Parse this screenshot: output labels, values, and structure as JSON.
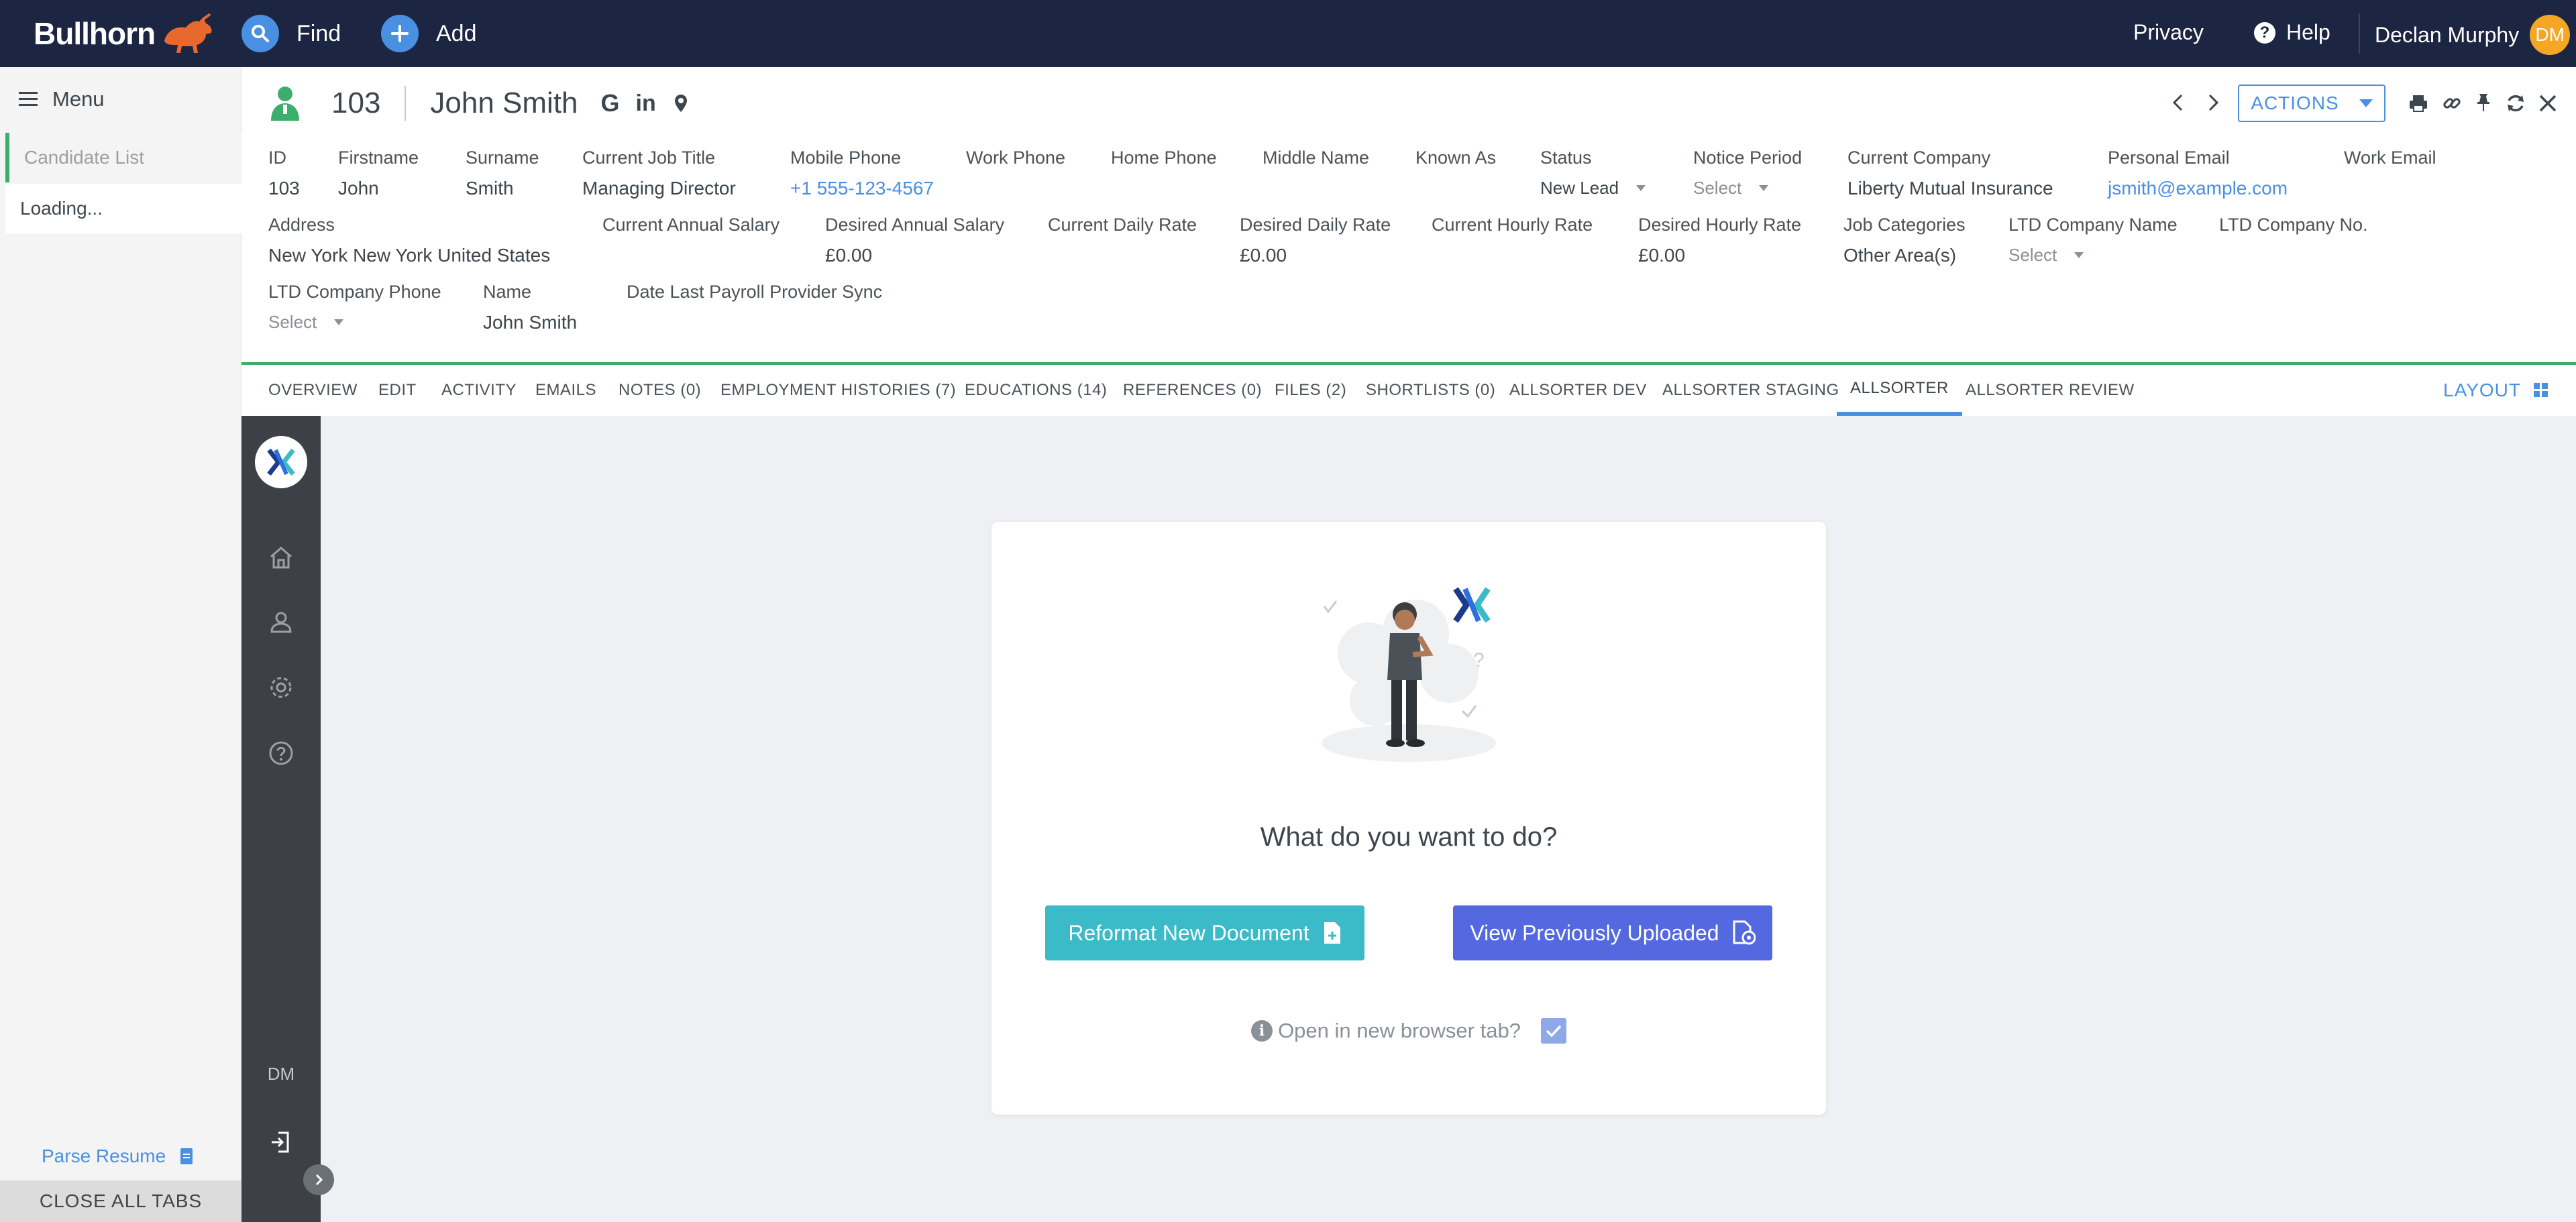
{
  "topbar": {
    "brand": "Bullhorn",
    "find_label": "Find",
    "add_label": "Add",
    "privacy_label": "Privacy",
    "help_label": "Help",
    "user_name": "Declan Murphy",
    "user_initials": "DM"
  },
  "menu": {
    "title": "Menu",
    "items": [
      {
        "label": "Candidate List"
      },
      {
        "label": "Loading..."
      }
    ],
    "parse_resume": "Parse Resume",
    "close_all": "CLOSE ALL TABS"
  },
  "record": {
    "id": "103",
    "name": "John Smith",
    "actions_label": "ACTIONS",
    "fields": {
      "id": {
        "label": "ID",
        "value": "103"
      },
      "firstname": {
        "label": "Firstname",
        "value": "John"
      },
      "surname": {
        "label": "Surname",
        "value": "Smith"
      },
      "job_title": {
        "label": "Current Job Title",
        "value": "Managing Director"
      },
      "mobile": {
        "label": "Mobile Phone",
        "value": "+1 555-123-4567"
      },
      "work_phone": {
        "label": "Work Phone",
        "value": ""
      },
      "home_phone": {
        "label": "Home Phone",
        "value": ""
      },
      "middle_name": {
        "label": "Middle Name",
        "value": ""
      },
      "known_as": {
        "label": "Known As",
        "value": ""
      },
      "status": {
        "label": "Status",
        "value": "New Lead"
      },
      "notice_period": {
        "label": "Notice Period",
        "value": "Select"
      },
      "current_company": {
        "label": "Current Company",
        "value": "Liberty Mutual Insurance"
      },
      "personal_email": {
        "label": "Personal Email",
        "value": "jsmith@example.com"
      },
      "work_email": {
        "label": "Work Email",
        "value": ""
      },
      "address": {
        "label": "Address",
        "value": "New York New York United States"
      },
      "cur_annual": {
        "label": "Current Annual Salary",
        "value": ""
      },
      "des_annual": {
        "label": "Desired Annual Salary",
        "value": "£0.00"
      },
      "cur_daily": {
        "label": "Current Daily Rate",
        "value": ""
      },
      "des_daily": {
        "label": "Desired Daily Rate",
        "value": "£0.00"
      },
      "cur_hourly": {
        "label": "Current Hourly Rate",
        "value": ""
      },
      "des_hourly": {
        "label": "Desired Hourly Rate",
        "value": "£0.00"
      },
      "job_categories": {
        "label": "Job Categories",
        "value": "Other Area(s)"
      },
      "ltd_name": {
        "label": "LTD Company Name",
        "value": "Select"
      },
      "ltd_no": {
        "label": "LTD Company No.",
        "value": ""
      },
      "ltd_phone": {
        "label": "LTD Company Phone",
        "value": "Select"
      },
      "name": {
        "label": "Name",
        "value": "John Smith"
      },
      "payroll_sync": {
        "label": "Date Last Payroll Provider Sync",
        "value": ""
      }
    }
  },
  "tabs": [
    {
      "label": "OVERVIEW"
    },
    {
      "label": "EDIT"
    },
    {
      "label": "ACTIVITY"
    },
    {
      "label": "EMAILS"
    },
    {
      "label": "NOTES (0)"
    },
    {
      "label": "EMPLOYMENT HISTORIES (7)"
    },
    {
      "label": "EDUCATIONS (14)"
    },
    {
      "label": "REFERENCES (0)"
    },
    {
      "label": "FILES (2)"
    },
    {
      "label": "SHORTLISTS (0)"
    },
    {
      "label": "ALLSORTER DEV"
    },
    {
      "label": "ALLSORTER STAGING"
    },
    {
      "label": "ALLSORTER"
    },
    {
      "label": "ALLSORTER REVIEW"
    }
  ],
  "active_tab": "ALLSORTER",
  "layout_label": "LAYOUT",
  "allsorter": {
    "strip_initials": "DM",
    "question": "What do you want to do?",
    "reformat_label": "Reformat New Document",
    "view_label": "View Previously Uploaded",
    "new_tab_label": "Open in new browser tab?",
    "new_tab_checked": true
  },
  "colors": {
    "topbar": "#1c2541",
    "accent": "#4a90e2",
    "status_green": "#3bae6b",
    "teal_button": "#3bbac8",
    "blue_button": "#5468e0",
    "avatar": "#f5a623"
  }
}
